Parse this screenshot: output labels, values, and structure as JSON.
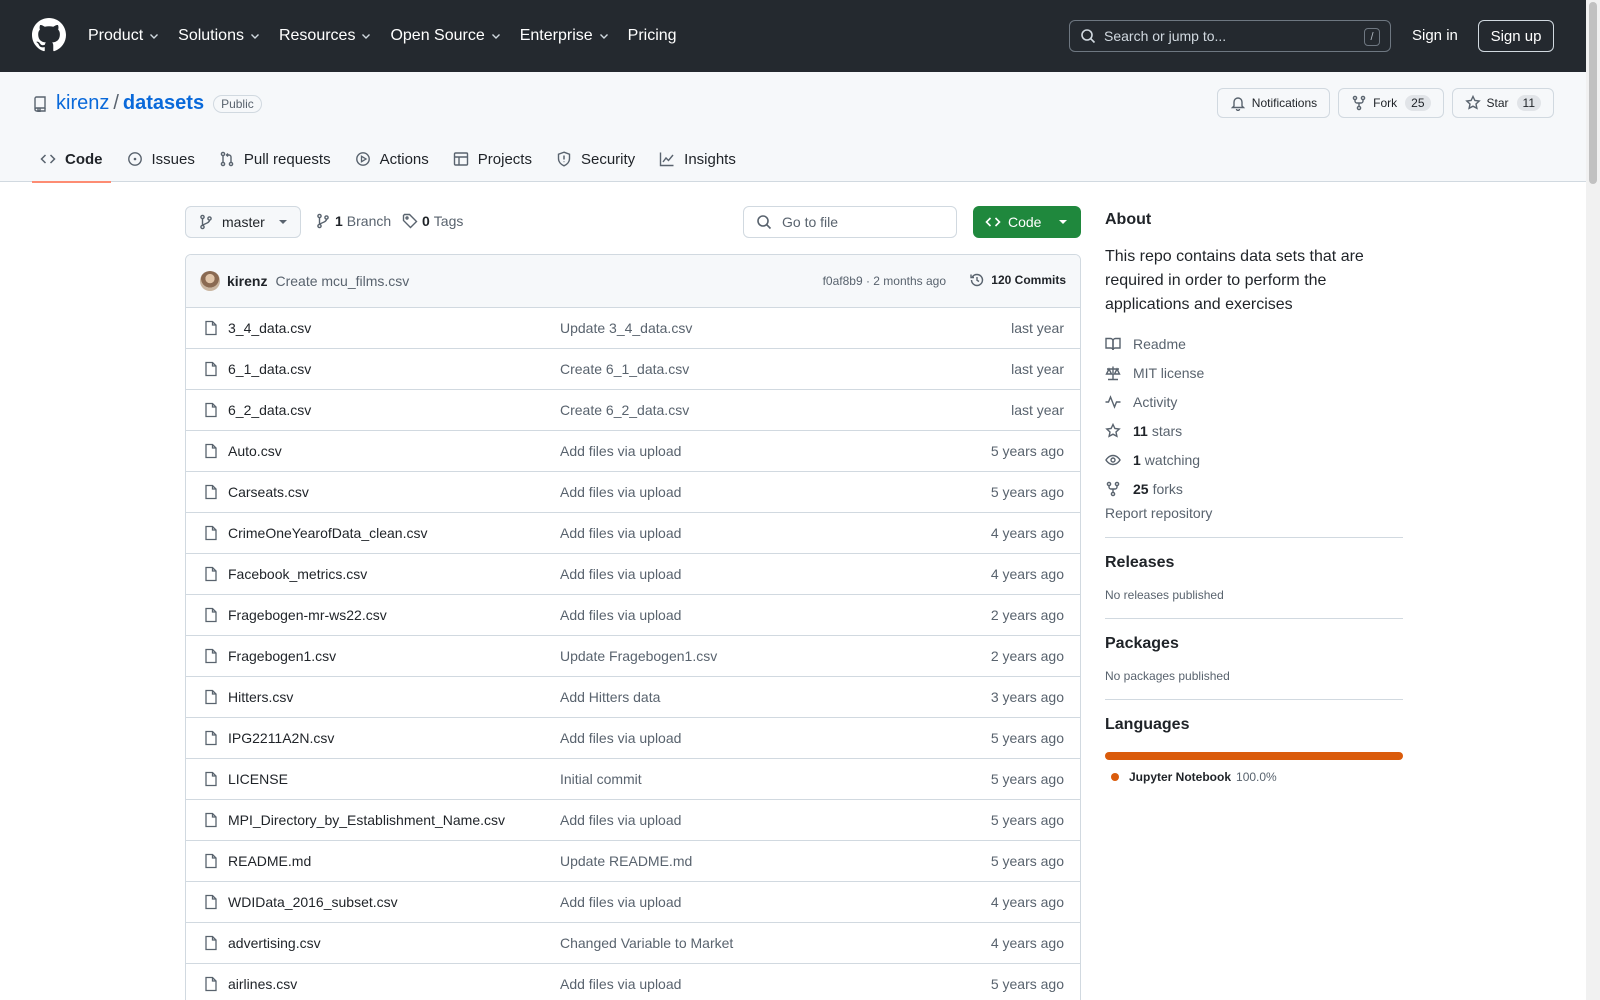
{
  "header": {
    "nav": [
      {
        "label": "Product",
        "dropdown": true
      },
      {
        "label": "Solutions",
        "dropdown": true
      },
      {
        "label": "Resources",
        "dropdown": true
      },
      {
        "label": "Open Source",
        "dropdown": true
      },
      {
        "label": "Enterprise",
        "dropdown": true
      },
      {
        "label": "Pricing",
        "dropdown": false
      }
    ],
    "search_placeholder": "Search or jump to...",
    "search_shortcut": "/",
    "sign_in": "Sign in",
    "sign_up": "Sign up"
  },
  "repo": {
    "owner": "kirenz",
    "separator": "/",
    "name": "datasets",
    "visibility": "Public",
    "notifications_label": "Notifications",
    "fork_label": "Fork",
    "fork_count": "25",
    "star_label": "Star",
    "star_count": "11",
    "tabs": [
      {
        "label": "Code",
        "icon": "code-icon",
        "active": true
      },
      {
        "label": "Issues",
        "icon": "issue-icon",
        "active": false
      },
      {
        "label": "Pull requests",
        "icon": "pull-request-icon",
        "active": false
      },
      {
        "label": "Actions",
        "icon": "play-icon",
        "active": false
      },
      {
        "label": "Projects",
        "icon": "table-icon",
        "active": false
      },
      {
        "label": "Security",
        "icon": "shield-icon",
        "active": false
      },
      {
        "label": "Insights",
        "icon": "graph-icon",
        "active": false
      }
    ]
  },
  "file_nav": {
    "branch": "master",
    "branch_count": "1",
    "branch_label": "Branch",
    "tag_count": "0",
    "tag_label": "Tags",
    "goto_placeholder": "Go to file",
    "code_button": "Code"
  },
  "commit": {
    "author": "kirenz",
    "message": "Create mcu_films.csv",
    "meta": "f0af8b9 · 2 months ago",
    "count_label": "120 Commits"
  },
  "files": [
    {
      "name": "3_4_data.csv",
      "message": "Update 3_4_data.csv",
      "date": "last year"
    },
    {
      "name": "6_1_data.csv",
      "message": "Create 6_1_data.csv",
      "date": "last year"
    },
    {
      "name": "6_2_data.csv",
      "message": "Create 6_2_data.csv",
      "date": "last year"
    },
    {
      "name": "Auto.csv",
      "message": "Add files via upload",
      "date": "5 years ago"
    },
    {
      "name": "Carseats.csv",
      "message": "Add files via upload",
      "date": "5 years ago"
    },
    {
      "name": "CrimeOneYearofData_clean.csv",
      "message": "Add files via upload",
      "date": "4 years ago"
    },
    {
      "name": "Facebook_metrics.csv",
      "message": "Add files via upload",
      "date": "4 years ago"
    },
    {
      "name": "Fragebogen-mr-ws22.csv",
      "message": "Add files via upload",
      "date": "2 years ago"
    },
    {
      "name": "Fragebogen1.csv",
      "message": "Update Fragebogen1.csv",
      "date": "2 years ago"
    },
    {
      "name": "Hitters.csv",
      "message": "Add Hitters data",
      "date": "3 years ago"
    },
    {
      "name": "IPG2211A2N.csv",
      "message": "Add files via upload",
      "date": "5 years ago"
    },
    {
      "name": "LICENSE",
      "message": "Initial commit",
      "date": "5 years ago"
    },
    {
      "name": "MPI_Directory_by_Establishment_Name.csv",
      "message": "Add files via upload",
      "date": "5 years ago"
    },
    {
      "name": "README.md",
      "message": "Update README.md",
      "date": "5 years ago"
    },
    {
      "name": "WDIData_2016_subset.csv",
      "message": "Add files via upload",
      "date": "4 years ago"
    },
    {
      "name": "advertising.csv",
      "message": "Changed Variable to Market",
      "date": "4 years ago"
    },
    {
      "name": "airlines.csv",
      "message": "Add files via upload",
      "date": "5 years ago"
    }
  ],
  "sidebar": {
    "about_title": "About",
    "description": "This repo contains data sets that are required in order to perform the applications and exercises",
    "readme": "Readme",
    "license": "MIT license",
    "activity": "Activity",
    "stars_count": "11",
    "stars_label": "stars",
    "watching_count": "1",
    "watching_label": "watching",
    "forks_count": "25",
    "forks_label": "forks",
    "report": "Report repository",
    "releases_title": "Releases",
    "releases_text": "No releases published",
    "packages_title": "Packages",
    "packages_text": "No packages published",
    "languages_title": "Languages",
    "language_name": "Jupyter Notebook",
    "language_percent": "100.0%",
    "language_color": "#da5b0b"
  }
}
